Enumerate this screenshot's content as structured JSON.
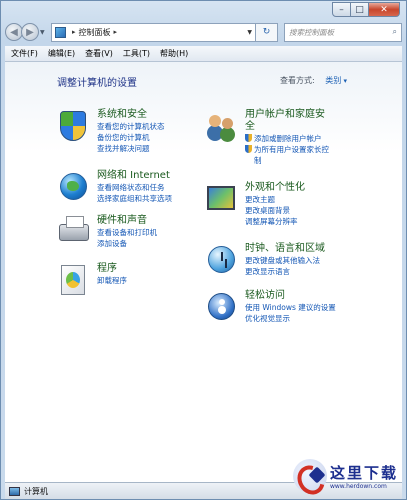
{
  "window": {
    "minimize": "–",
    "maximize": "□",
    "close": "✕"
  },
  "nav": {
    "back": "◀",
    "forward": "▶",
    "address_arrow": "▸",
    "breadcrumb": "控制面板",
    "breadcrumb_sep": "▸",
    "refresh": "↻",
    "search_placeholder": "搜索控制面板",
    "search_icon": "⌕"
  },
  "menu": [
    "文件(F)",
    "编辑(E)",
    "查看(V)",
    "工具(T)",
    "帮助(H)"
  ],
  "content": {
    "title": "调整计算机的设置",
    "view_by_label": "查看方式:",
    "view_by_value": "类别"
  },
  "categories_left": [
    {
      "icon": "security-shield-icon",
      "title": "系统和安全",
      "links": [
        "查看您的计算机状态",
        "备份您的计算机",
        "查找并解决问题"
      ]
    },
    {
      "icon": "network-globe-icon",
      "title": "网络和 Internet",
      "links": [
        "查看网络状态和任务",
        "选择家庭组和共享选项"
      ]
    },
    {
      "icon": "printer-icon",
      "title": "硬件和声音",
      "links": [
        "查看设备和打印机",
        "添加设备"
      ]
    },
    {
      "icon": "programs-icon",
      "title": "程序",
      "links": [
        "卸载程序"
      ]
    }
  ],
  "categories_right": [
    {
      "icon": "users-icon",
      "title_line1": "用户帐户和家庭安",
      "title_line2": "全",
      "links": [
        "添加或删除用户帐户",
        "为所有用户设置家长控",
        "制"
      ]
    },
    {
      "icon": "appearance-icon",
      "title": "外观和个性化",
      "links": [
        "更改主题",
        "更改桌面背景",
        "调整屏幕分辨率"
      ]
    },
    {
      "icon": "clock-globe-icon",
      "title": "时钟、语言和区域",
      "links": [
        "更改键盘或其他输入法",
        "更改显示语言"
      ]
    },
    {
      "icon": "ease-of-access-icon",
      "title": "轻松访问",
      "links": [
        "使用 Windows 建议的设置",
        "优化视觉显示"
      ]
    }
  ],
  "status": {
    "text": "计算机"
  },
  "watermark": {
    "big": "这里下载",
    "small": "www.herdown.com"
  }
}
